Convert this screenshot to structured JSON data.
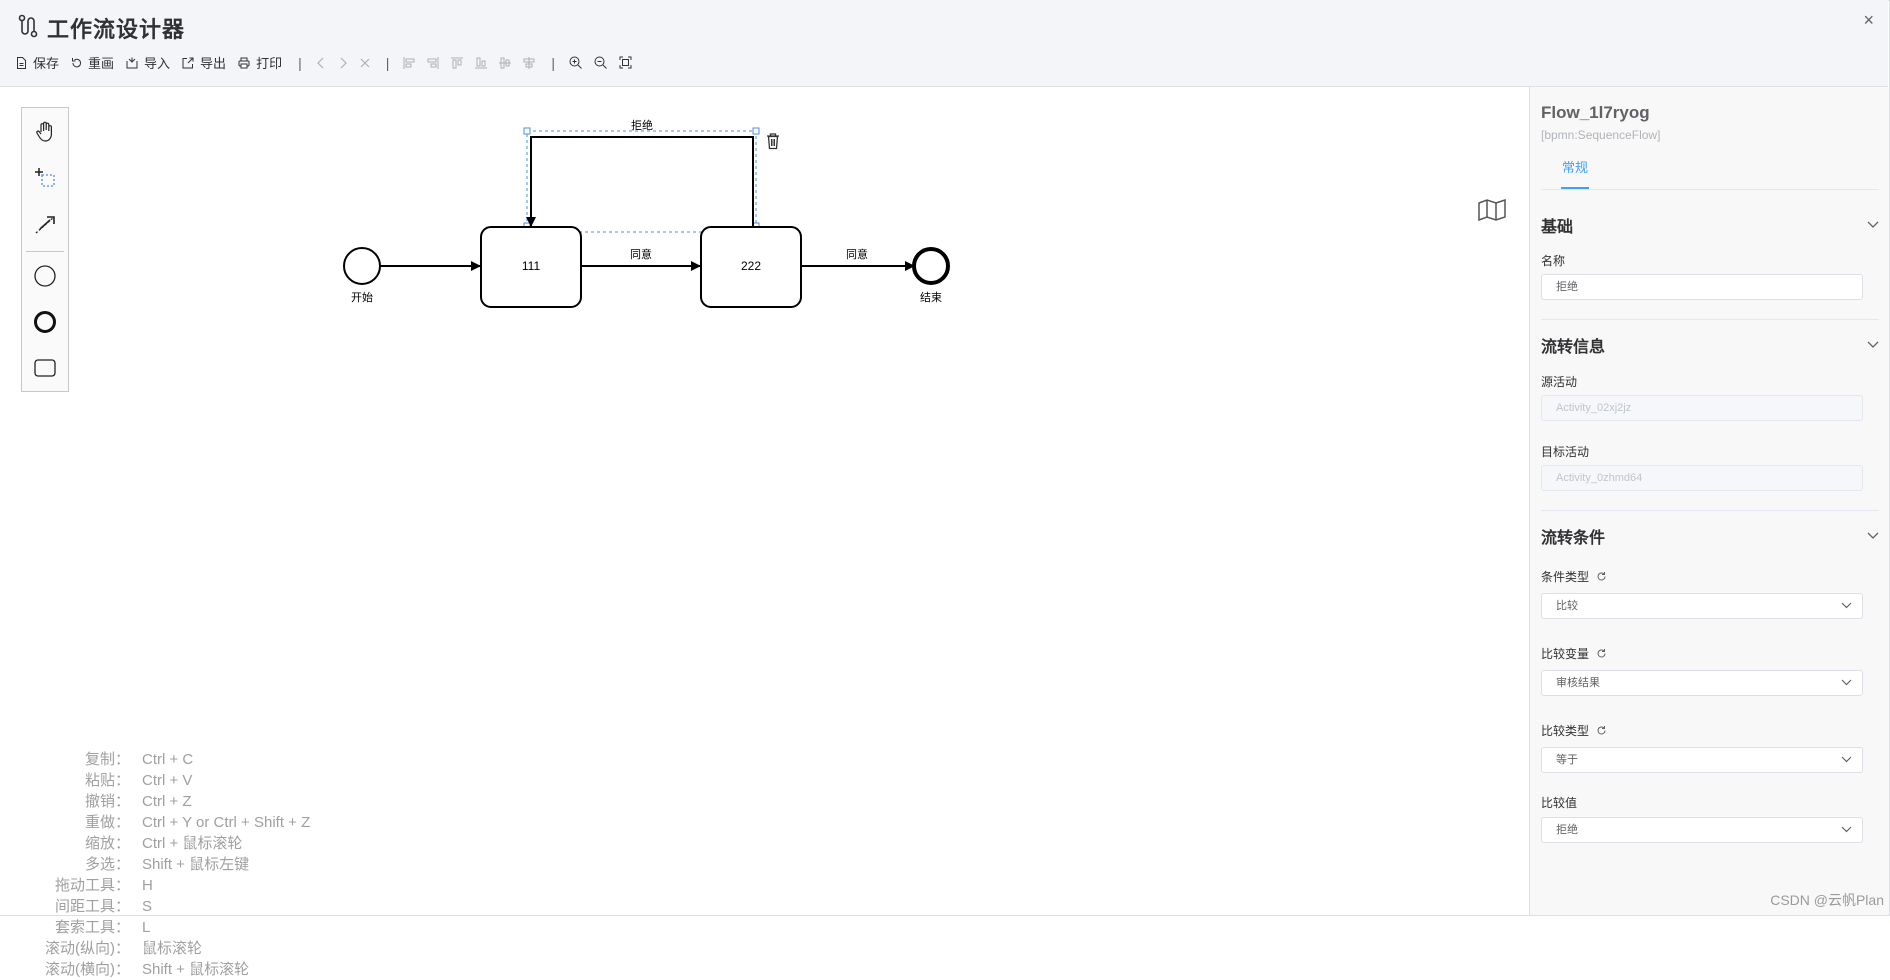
{
  "header": {
    "title": "工作流设计器",
    "close_label": "×",
    "toolbar": {
      "save": "保存",
      "redraw": "重画",
      "import": "导入",
      "export": "导出",
      "print": "打印",
      "separator": "|"
    }
  },
  "diagram": {
    "start_label": "开始",
    "end_label": "结束",
    "task1_label": "111",
    "task2_label": "222",
    "flow1_label": "同意",
    "flow2_label": "同意",
    "reject_label": "拒绝"
  },
  "shortcuts": [
    {
      "key": "复制：",
      "value": "Ctrl + C"
    },
    {
      "key": "粘贴：",
      "value": "Ctrl + V"
    },
    {
      "key": "撤销：",
      "value": "Ctrl + Z"
    },
    {
      "key": "重做：",
      "value": "Ctrl + Y or Ctrl + Shift + Z"
    },
    {
      "key": "缩放：",
      "value": "Ctrl + 鼠标滚轮"
    },
    {
      "key": "多选：",
      "value": "Shift + 鼠标左键"
    },
    {
      "key": "拖动工具：",
      "value": "H"
    },
    {
      "key": "间距工具：",
      "value": "S"
    },
    {
      "key": "套索工具：",
      "value": "L"
    },
    {
      "key": "滚动(纵向)：",
      "value": "鼠标滚轮"
    },
    {
      "key": "滚动(横向)：",
      "value": "Shift + 鼠标滚轮"
    }
  ],
  "panel": {
    "element_id": "Flow_1l7ryog",
    "element_type": "[bpmn:SequenceFlow]",
    "tab_general": "常规",
    "sections": {
      "basic": "基础",
      "flow_info": "流转信息",
      "flow_condition": "流转条件"
    },
    "fields": {
      "name_label": "名称",
      "name_value": "拒绝",
      "source_label": "源活动",
      "source_value": "Activity_02xj2jz",
      "target_label": "目标活动",
      "target_value": "Activity_0zhmd64",
      "cond_type_label": "条件类型",
      "cond_type_value": "比较",
      "compare_var_label": "比较变量",
      "compare_var_value": "审核结果",
      "compare_type_label": "比较类型",
      "compare_type_value": "等于",
      "compare_value_label": "比较值",
      "compare_value_value": "拒绝"
    }
  },
  "watermark": "CSDN @云帆Plan",
  "colors": {
    "accent": "#409eff",
    "header_bg": "#f4f5f9",
    "panel_bg": "#f8f8f8",
    "selection": "#4a90e2"
  }
}
